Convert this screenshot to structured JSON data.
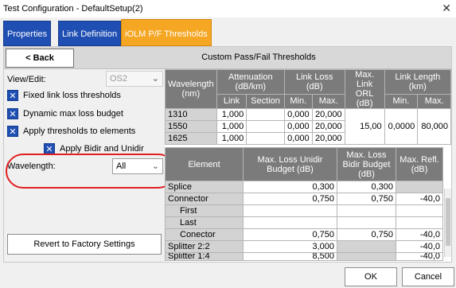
{
  "window": {
    "title": "Test Configuration - DefaultSetup(2)"
  },
  "tabs": [
    {
      "label": "Properties"
    },
    {
      "label": "Link Definition"
    },
    {
      "label": "iOLM P/F Thresholds"
    }
  ],
  "toolbar": {
    "back_label": "< Back",
    "title": "Custom Pass/Fail Thresholds"
  },
  "left": {
    "view_edit_label": "View/Edit:",
    "view_edit_value": "OS2",
    "checks": [
      {
        "label": "Fixed link loss thresholds",
        "checked": true
      },
      {
        "label": "Dynamic max loss budget",
        "checked": true
      },
      {
        "label": "Apply thresholds to elements",
        "checked": true
      },
      {
        "label": "Apply Bidir and Unidir",
        "checked": true
      }
    ],
    "wavelength_label": "Wavelength:",
    "wavelength_value": "All",
    "revert_label": "Revert to Factory Settings"
  },
  "wave_table": {
    "headers": {
      "wavelength": "Wavelength (nm)",
      "attenuation": "Attenuation (dB/km)",
      "link_loss": "Link Loss (dB)",
      "max_link_orl": "Max. Link ORL (dB)",
      "link_length": "Link Length (km)",
      "sub_link": "Link",
      "sub_section": "Section",
      "sub_min": "Min.",
      "sub_max": "Max.",
      "sub_len_min": "Min.",
      "sub_len_max": "Max."
    },
    "rows": [
      {
        "wl": "1310",
        "link": "1,000",
        "section": "",
        "min": "0,000",
        "max": "20,000"
      },
      {
        "wl": "1550",
        "link": "1,000",
        "section": "",
        "min": "0,000",
        "max": "20,000"
      },
      {
        "wl": "1625",
        "link": "1,000",
        "section": "",
        "min": "0,000",
        "max": "20,000"
      }
    ],
    "orl": "15,00",
    "len_min": "0,0000",
    "len_max": "80,000"
  },
  "elem_table": {
    "headers": {
      "element": "Element",
      "unidir": "Max. Loss Unidir Budget (dB)",
      "bidir": "Max. Loss Bidir Budget (dB)",
      "refl": "Max. Refl. (dB)"
    },
    "rows": [
      {
        "name": "Splice",
        "indent": false,
        "unidir": "0,300",
        "bidir": "0,300",
        "refl": ""
      },
      {
        "name": "Connector",
        "indent": false,
        "unidir": "0,750",
        "bidir": "0,750",
        "refl": "-40,0"
      },
      {
        "name": "First",
        "indent": true,
        "unidir": "",
        "bidir": "",
        "refl": ""
      },
      {
        "name": "Last",
        "indent": true,
        "unidir": "",
        "bidir": "",
        "refl": ""
      },
      {
        "name": "Conector",
        "indent": true,
        "unidir": "0,750",
        "bidir": "0,750",
        "refl": "-40,0"
      },
      {
        "name": "Splitter 2:2",
        "indent": false,
        "unidir": "3,000",
        "bidir": "",
        "refl": "-40,0"
      },
      {
        "name": "Splitter 1:4",
        "indent": false,
        "unidir": "8,500",
        "bidir": "",
        "refl": "-40,0"
      }
    ]
  },
  "footer": {
    "ok_label": "OK",
    "cancel_label": "Cancel"
  }
}
